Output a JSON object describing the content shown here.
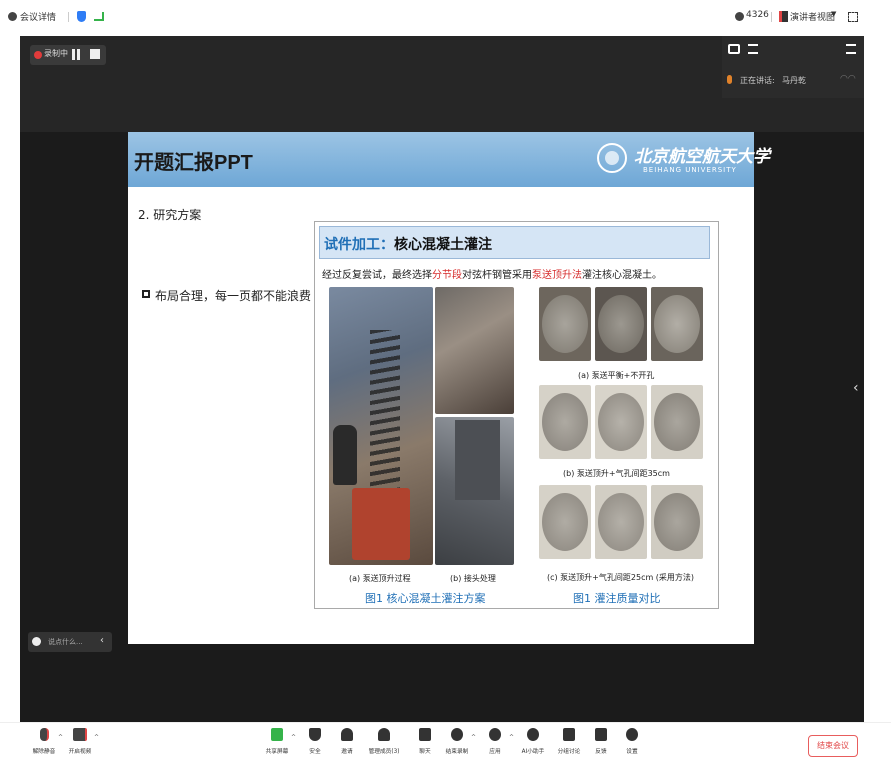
{
  "topbar": {
    "meeting_info": "会议详情",
    "meeting_id": "4326",
    "presenter_view": "演讲者视图",
    "colors": {
      "shield": "#2f7df5",
      "signal": "#35b34a"
    }
  },
  "recording": {
    "label": "录制中"
  },
  "speaker_panel": {
    "speaking_label": "正在讲话:",
    "speaker_name": "马丹乾"
  },
  "slide": {
    "title": "开题汇报PPT",
    "university_cn": "北京航空航天大学",
    "university_en": "BEIHANG UNIVERSITY",
    "section_heading": "2. 研究方案",
    "bullet": "布局合理，每一页都不能浪费",
    "inner": {
      "title_prefix": "试件加工：",
      "title_main": "核心混凝土灌注",
      "desc_part1": "经过反复尝试，最终选择",
      "desc_red1": "分节段",
      "desc_part2": "对弦杆钢管采用",
      "desc_red2": "泵送顶升法",
      "desc_part3": "灌注核心混凝土。",
      "caption_a_left": "(a) 泵送顶升过程",
      "caption_b_left": "(b) 接头处理",
      "caption_a_right": "(a) 泵送平衡+不开孔",
      "caption_b_right": "(b) 泵送顶升+气孔间距35cm",
      "caption_c_right": "(c) 泵送顶升+气孔间距25cm (采用方法)",
      "figure1_left": "图1  核心混凝土灌注方案",
      "figure1_right": "图1  灌注质量对比"
    }
  },
  "chat": {
    "preview": "说点什么..."
  },
  "toolbar": {
    "items": [
      {
        "label": "解除静音"
      },
      {
        "label": "开启视频"
      },
      {
        "label": "共享屏幕"
      },
      {
        "label": "安全"
      },
      {
        "label": "邀请"
      },
      {
        "label": "管理成员(3)"
      },
      {
        "label": "聊天"
      },
      {
        "label": "结束录制"
      },
      {
        "label": "应用"
      },
      {
        "label": "AI小助手"
      },
      {
        "label": "分组讨论"
      },
      {
        "label": "反馈"
      },
      {
        "label": "设置"
      }
    ],
    "end_meeting": "结束会议",
    "colors": {
      "share": "#35b34a",
      "end": "#e04545"
    }
  }
}
